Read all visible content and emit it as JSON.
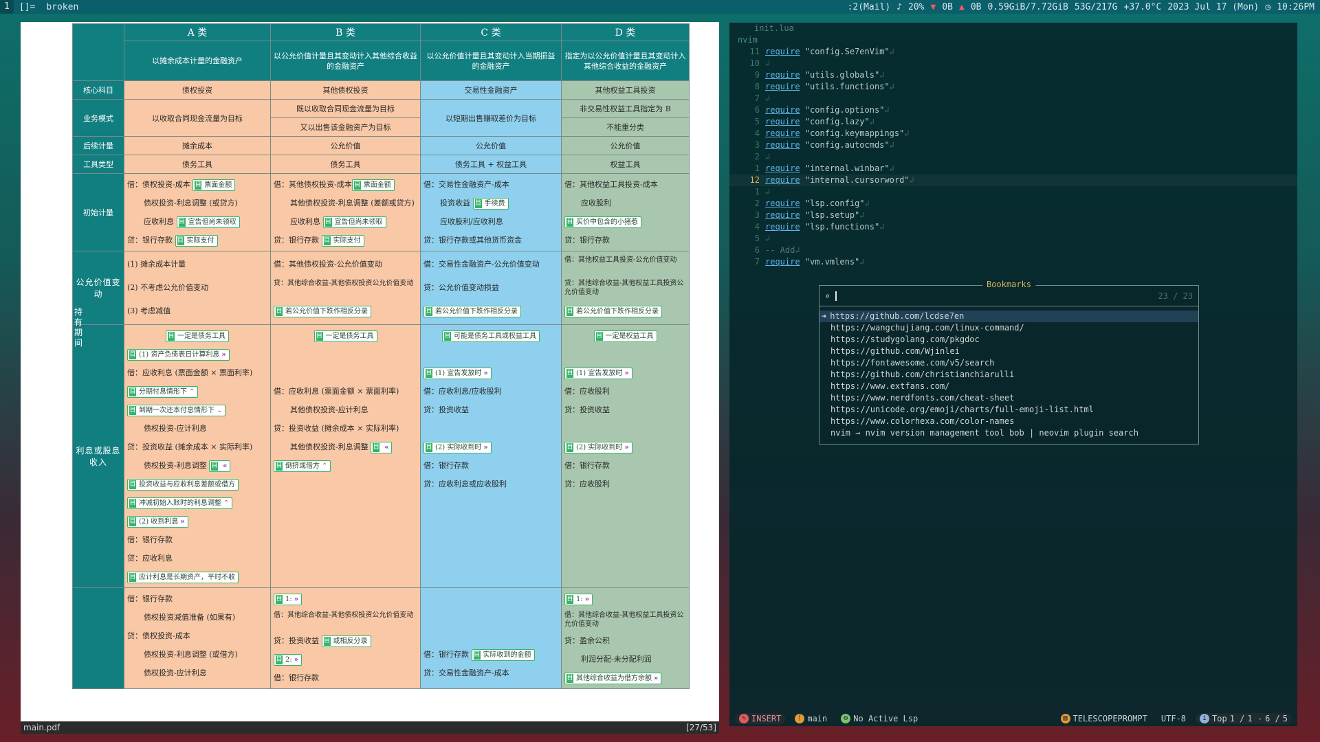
{
  "topbar": {
    "workspace": "1",
    "layout": "[]=",
    "title": "broken",
    "mail": ":2(Mail)",
    "volume": "20%",
    "net_down": "0B",
    "net_up": "0B",
    "mem": "0.59GiB/7.72GiB",
    "disk": "53G/217G",
    "temp": "+37.0°C",
    "date": "2023 Jul 17 (Mon)",
    "time": "10:26PM"
  },
  "pdf": {
    "filename": "main.pdf",
    "page": "[27/53]",
    "cols": [
      "A 类",
      "B 类",
      "C 类",
      "D 类"
    ],
    "col_desc": [
      "以摊余成本计量的金融资产",
      "以公允价值计量且其变动计入其他综合收益的金融资产",
      "以公允价值计量且其变动计入当期损益的金融资产",
      "指定为以公允价值计量且其变动计入其他综合收益的金融资产"
    ],
    "rows": {
      "core_label": "核心科目",
      "core": [
        "债权投资",
        "其他债权投资",
        "交易性金融资产",
        "其他权益工具投资"
      ],
      "biz_label": "业务模式",
      "biz_a": "以收取合同现金流量为目标",
      "biz_b1": "既以收取合同现金流量为目标",
      "biz_b2": "又以出售该金融资产为目标",
      "biz_c": "以短期出售赚取差价为目标",
      "biz_d1": "非交易性权益工具指定为 B",
      "biz_d2": "不能重分类",
      "after_label": "后续计量",
      "after": [
        "摊余成本",
        "公允价值",
        "公允价值",
        "公允价值"
      ],
      "tool_label": "工具类型",
      "tool": [
        "债务工具",
        "债务工具",
        "债务工具 + 权益工具",
        "权益工具"
      ],
      "init_label": "初始计量",
      "fv_label": "公允价值变动",
      "hold_label": "持有期间",
      "int_label": "利息或股息收入"
    },
    "init": {
      "a": [
        "借：债权投资-成本",
        "债权投资-利息调整 (或贷方)",
        "应收利息",
        "贷：银行存款"
      ],
      "a_tags": [
        "票面金额",
        "",
        "宣告但尚未领取",
        "实际支付"
      ],
      "b": [
        "借：其他债权投资-成本",
        "其他债权投资-利息调整 (差额或贷方)",
        "应收利息",
        "贷：银行存款"
      ],
      "b_tags": [
        "票面金额",
        "",
        "宣告但尚未领取",
        "实际支付"
      ],
      "c": [
        "借：交易性金融资产-成本",
        "投资收益",
        "应收股利/应收利息",
        "贷：银行存款或其他货币资金"
      ],
      "c_tags": [
        "",
        "手续费",
        "",
        ""
      ],
      "d": [
        "借：其他权益工具投资-成本",
        "应收股利",
        "",
        "贷：银行存款"
      ],
      "d_tags": [
        "",
        "",
        "买价中包含的小猪惹",
        ""
      ]
    },
    "fv": {
      "a": [
        "(1) 摊余成本计量",
        "(2) 不考虑公允价值变动",
        "(3) 考虑减值"
      ],
      "b": [
        "借：其他债权投资-公允价值变动",
        "贷：其他综合收益-其他债权投资公允价值变动",
        "若公允价值下跌作相反分录"
      ],
      "c": [
        "借：交易性金融资产-公允价值变动",
        "贷：公允价值变动损益",
        "若公允价值下跌作相反分录"
      ],
      "d": [
        "借：其他权益工具投资-公允价值变动",
        "贷：其他综合收益-其他权益工具投资公允价值变动",
        "若公允价值下跌作相反分录"
      ]
    },
    "inc": {
      "a": [
        "一定是债务工具",
        "(1) 资产负债表日计算利息",
        "借：应收利息 (票面金额 × 票面利率)",
        "分期付息情形下",
        "到期一次还本付息情形下",
        "债权投资-应计利息",
        "贷：投资收益 (摊余成本 × 实际利率)",
        "债权投资-利息调整",
        "投资收益与应收利息差额或借方",
        "冲减初始入账时的利息调整",
        "(2) 收到利息",
        "借：银行存款",
        "贷：应收利息",
        "应计利息是长期资产，平时不收"
      ],
      "b": [
        "一定是债务工具",
        "借：应收利息 (票面金额 × 票面利率)",
        "其他债权投资-应计利息",
        "贷：投资收益 (摊余成本 × 实际利率)",
        "其他债权投资-利息调整",
        "倒挤或借方"
      ],
      "c": [
        "可能是债务工具或权益工具",
        "(1) 宣告发放时",
        "借：应收利息/应收股利",
        "贷：投资收益",
        "(2) 实际收到时",
        "借：银行存款",
        "贷：应收利息或应收股利"
      ],
      "d": [
        "一定是权益工具",
        "(1) 宣告发放时",
        "借：应收股利",
        "贷：投资收益",
        "(2) 实际收到时",
        "借：银行存款",
        "贷：应收股利"
      ]
    },
    "last": {
      "a": [
        "借：银行存款",
        "债权投资减值准备 (如果有)",
        "贷：债权投资-成本",
        "债权投资-利息调整 (或借方)",
        "债权投资-应计利息"
      ],
      "b": [
        "1:",
        "借：其他综合收益-其他债权投资公允价值变动",
        "贷：投资收益",
        "2:",
        "借：银行存款"
      ],
      "b_tag": "或相反分录",
      "c": [
        "借：银行存款",
        "贷：交易性金融资产-成本"
      ],
      "c_tag": "实际收到的金额",
      "d": [
        "1:",
        "借：其他综合收益-其他权益工具投资公允价值变动",
        "贷：盈余公积",
        "利润分配-未分配利润",
        "其他综合收益为借方余额"
      ]
    }
  },
  "nvim": {
    "tab": "init.lua",
    "dir": "nvim",
    "lines": [
      {
        "n": "11",
        "code": "\"config.Se7enVim\""
      },
      {
        "n": "10",
        "code": ""
      },
      {
        "n": "9",
        "code": "\"utils.globals\""
      },
      {
        "n": "8",
        "code": "\"utils.functions\""
      },
      {
        "n": "7",
        "code": ""
      },
      {
        "n": "6",
        "code": "\"config.options\""
      },
      {
        "n": "5",
        "code": "\"config.lazy\""
      },
      {
        "n": "4",
        "code": "\"config.keymappings\""
      },
      {
        "n": "3",
        "code": "\"config.autocmds\""
      },
      {
        "n": "2",
        "code": ""
      },
      {
        "n": "1",
        "code": "\"internal.winbar\""
      },
      {
        "n": "12",
        "code": "\"internal.cursorword\"",
        "cur": true
      },
      {
        "n": "1",
        "code": ""
      },
      {
        "n": "2",
        "code": "\"lsp.config\""
      },
      {
        "n": "3",
        "code": "\"lsp.setup\""
      },
      {
        "n": "4",
        "code": "\"lsp.functions\""
      },
      {
        "n": "5",
        "code": ""
      },
      {
        "n": "6",
        "code": "-- Add",
        "cmt": true
      },
      {
        "n": "7",
        "code": "\"vm.vmlens\""
      }
    ],
    "keyword": "require",
    "eol": "↲",
    "telescope": {
      "title": "Bookmarks",
      "count": "23 / 23",
      "items": [
        "https://github.com/lcdse7en",
        "https://wangchujiang.com/linux-command/",
        "https://studygolang.com/pkgdoc",
        "https://github.com/Wjinlei",
        "https://fontawesome.com/v5/search",
        "https://github.com/christianchiarulli",
        "https://www.extfans.com/",
        "https://www.nerdfonts.com/cheat-sheet",
        "https://unicode.org/emoji/charts/full-emoji-list.html",
        "https://www.colorhexa.com/color-names",
        "nvim → nvim version management tool bob | neovim plugin search"
      ]
    },
    "status": {
      "mode": "INSERT",
      "branch": "main",
      "lsp": "No Active Lsp",
      "prompt": "TELESCOPEPROMPT",
      "enc": "UTF-8",
      "pos": "Top",
      "line": "1 /",
      "col": "1 -",
      "progress": "6 /",
      "total": "5"
    }
  }
}
